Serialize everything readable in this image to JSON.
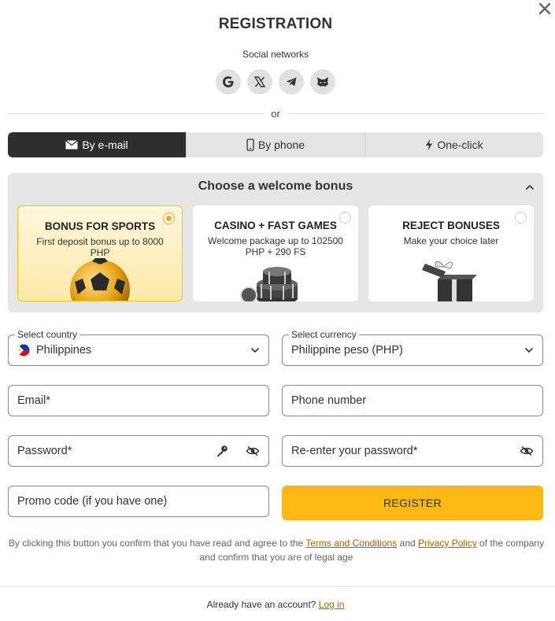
{
  "title": "REGISTRATION",
  "social": {
    "label": "Social networks",
    "networks": [
      "google-icon",
      "x-icon",
      "telegram-icon",
      "metamask-icon"
    ]
  },
  "divider_text": "or",
  "tabs": [
    {
      "label": "By e-mail",
      "icon": "envelope-icon",
      "active": true
    },
    {
      "label": "By phone",
      "icon": "phone-icon",
      "active": false
    },
    {
      "label": "One-click",
      "icon": "lightning-icon",
      "active": false
    }
  ],
  "bonus": {
    "header": "Choose a welcome bonus",
    "cards": [
      {
        "title": "BONUS FOR SPORTS",
        "desc": "First deposit bonus up to 8000 PHP",
        "selected": true,
        "art": "soccer-ball-icon"
      },
      {
        "title": "CASINO + FAST GAMES",
        "desc": "Welcome package up to 102500 PHP + 290 FS",
        "selected": false,
        "art": "casino-chips-icon"
      },
      {
        "title": "REJECT BONUSES",
        "desc": "Make your choice later",
        "selected": false,
        "art": "gift-box-icon"
      }
    ]
  },
  "form": {
    "country": {
      "legend": "Select country",
      "value": "Philippines"
    },
    "currency": {
      "legend": "Select currency",
      "value": "Philippine peso (PHP)"
    },
    "email": {
      "placeholder": "Email*"
    },
    "phone": {
      "placeholder": "Phone number"
    },
    "password": {
      "placeholder": "Password*"
    },
    "repassword": {
      "placeholder": "Re-enter your password*"
    },
    "promo": {
      "placeholder": "Promo code (if you have one)"
    },
    "register_label": "REGISTER"
  },
  "terms": {
    "before": "By clicking this button you confirm that you have read and agree to the ",
    "terms_link": "Terms and Conditions",
    "and": " and ",
    "privacy_link": "Privacy Policy",
    "after": " of the company and confirm that you are of legal age"
  },
  "footer": {
    "text": "Already have an account? ",
    "link": "Log in"
  },
  "colors": {
    "accent": "#fdb813",
    "link": "#9a6a00",
    "active_tab": "#2e2e2e"
  }
}
